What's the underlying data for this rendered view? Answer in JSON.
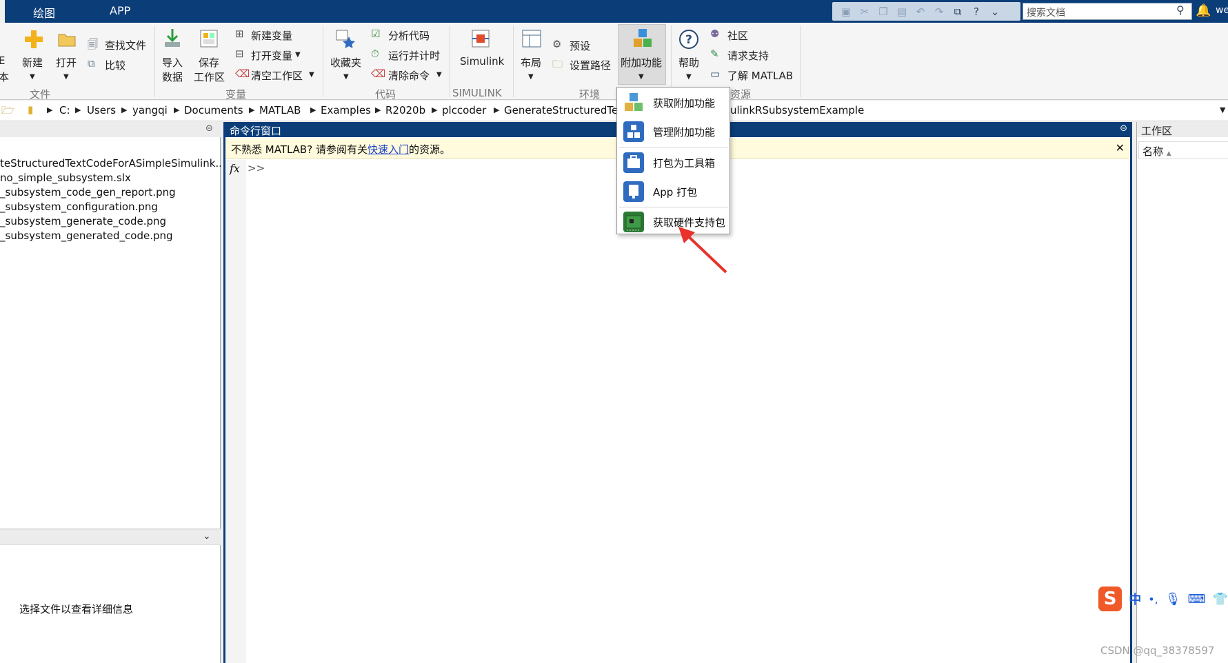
{
  "tabs": [
    "绘图",
    "APP"
  ],
  "search": {
    "placeholder": "搜索文档"
  },
  "user_partial": "we",
  "ribbon": {
    "partial_label_1": "E",
    "partial_label_2": "本",
    "new_label": "新建",
    "open_label": "打开",
    "find_files": "查找文件",
    "compare": "比较",
    "section_file": "文件",
    "import_label_1": "导入",
    "import_label_2": "数据",
    "save_label_1": "保存",
    "save_label_2": "工作区",
    "new_variable": "新建变量",
    "open_variable": "打开变量",
    "clear_workspace": "清空工作区",
    "section_variable": "变量",
    "favorites_label": "收藏夹",
    "analyze_code": "分析代码",
    "run_and_time": "运行并计时",
    "clear_commands": "清除命令",
    "section_code": "代码",
    "simulink_label": "Simulink",
    "section_simulink": "SIMULINK",
    "layout_label": "布局",
    "preferences": "预设",
    "set_path": "设置路径",
    "addons_label": "附加功能",
    "section_environment": "环境",
    "help_label": "帮助",
    "community": "社区",
    "request_support": "请求支持",
    "learn_matlab": "了解 MATLAB",
    "section_resources_partial": "资源"
  },
  "address": {
    "segments": [
      "C:",
      "Users",
      "yangqi",
      "Documents",
      "MATLAB",
      "Examples",
      "R2020b",
      "plccoder",
      "GenerateStructuredTe"
    ],
    "tail": "ulinkRSubsystemExample"
  },
  "left_pane": {
    "files": [
      "teStructuredTextCodeForASimpleSimulink..",
      "no_simple_subsystem.slx",
      "_subsystem_code_gen_report.png",
      "_subsystem_configuration.png",
      "_subsystem_generate_code.png",
      "_subsystem_generated_code.png"
    ],
    "details_hint": "选择文件以查看详细信息"
  },
  "command_window": {
    "title": "命令行窗口",
    "notice_prefix": "不熟悉 MATLAB? 请参阅有关",
    "notice_link": "快速入门",
    "notice_suffix": "的资源。",
    "fx": "fx",
    "prompt": ">>"
  },
  "workspace": {
    "title": "工作区",
    "col_name": "名称",
    "sort_glyph": "▲"
  },
  "addons_menu": [
    {
      "label": "获取附加功能",
      "icon": "cubes-icon"
    },
    {
      "label": "管理附加功能",
      "icon": "manage-addons-icon"
    },
    {
      "label": "打包为工具箱",
      "icon": "toolbox-icon"
    },
    {
      "label": "App 打包",
      "icon": "app-package-icon"
    },
    {
      "label": "获取硬件支持包",
      "icon": "hardware-board-icon"
    }
  ],
  "ime": {
    "lang": "中",
    "punct": "•,"
  },
  "watermark": "CSDN @qq_38378597",
  "colors": {
    "title_bar": "#0b3d78",
    "notice_bg": "#fffbdc",
    "link": "#1a3fcc",
    "annotation_arrow": "#e8322b"
  }
}
